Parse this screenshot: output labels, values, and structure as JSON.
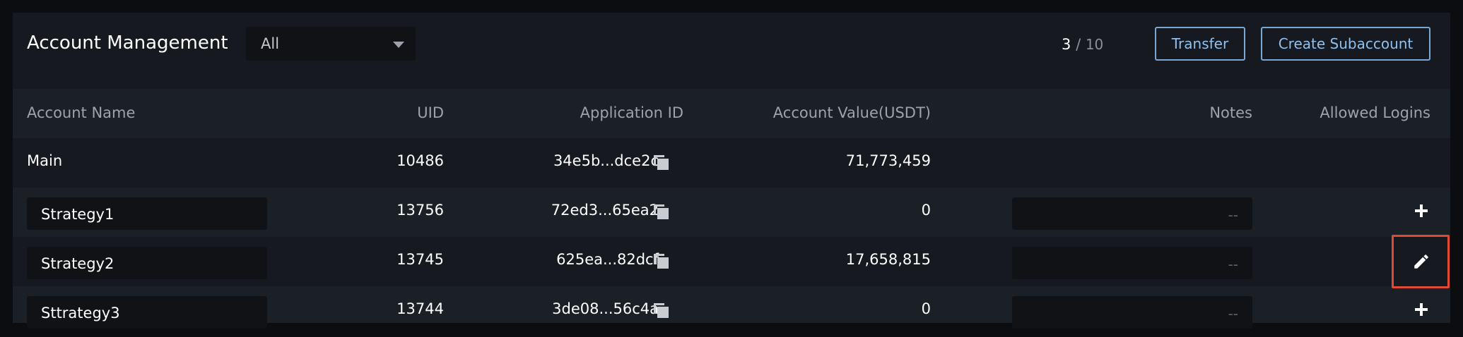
{
  "header": {
    "title": "Account Management",
    "filter": {
      "selected": "All"
    },
    "counter": {
      "current": "3",
      "separator": "/",
      "total": "10"
    },
    "transfer_label": "Transfer",
    "create_label": "Create Subaccount"
  },
  "table": {
    "columns": {
      "name": "Account Name",
      "uid": "UID",
      "app_id": "Application ID",
      "value": "Account Value(USDT)",
      "notes": "Notes",
      "logins": "Allowed Logins"
    },
    "main": {
      "name": "Main",
      "uid": "10486",
      "app_id": "34e5b...dce2c",
      "value": "71,773,459"
    },
    "rows": [
      {
        "name": "Strategy1",
        "uid": "13756",
        "app_id": "72ed3...65ea2",
        "value": "0",
        "notes": "--",
        "action_icon": "plus-icon"
      },
      {
        "name": "Strategy2",
        "uid": "13745",
        "app_id": "625ea...82dcf",
        "value": "17,658,815",
        "notes": "--",
        "action_icon": "pencil-icon"
      },
      {
        "name": "Sttrategy3",
        "uid": "13744",
        "app_id": "3de08...56c4a",
        "value": "0",
        "notes": "--",
        "action_icon": "plus-icon"
      }
    ]
  },
  "colors": {
    "accent": "#8ec0f0",
    "highlight": "#e04a32",
    "background": "#1b1f26"
  }
}
